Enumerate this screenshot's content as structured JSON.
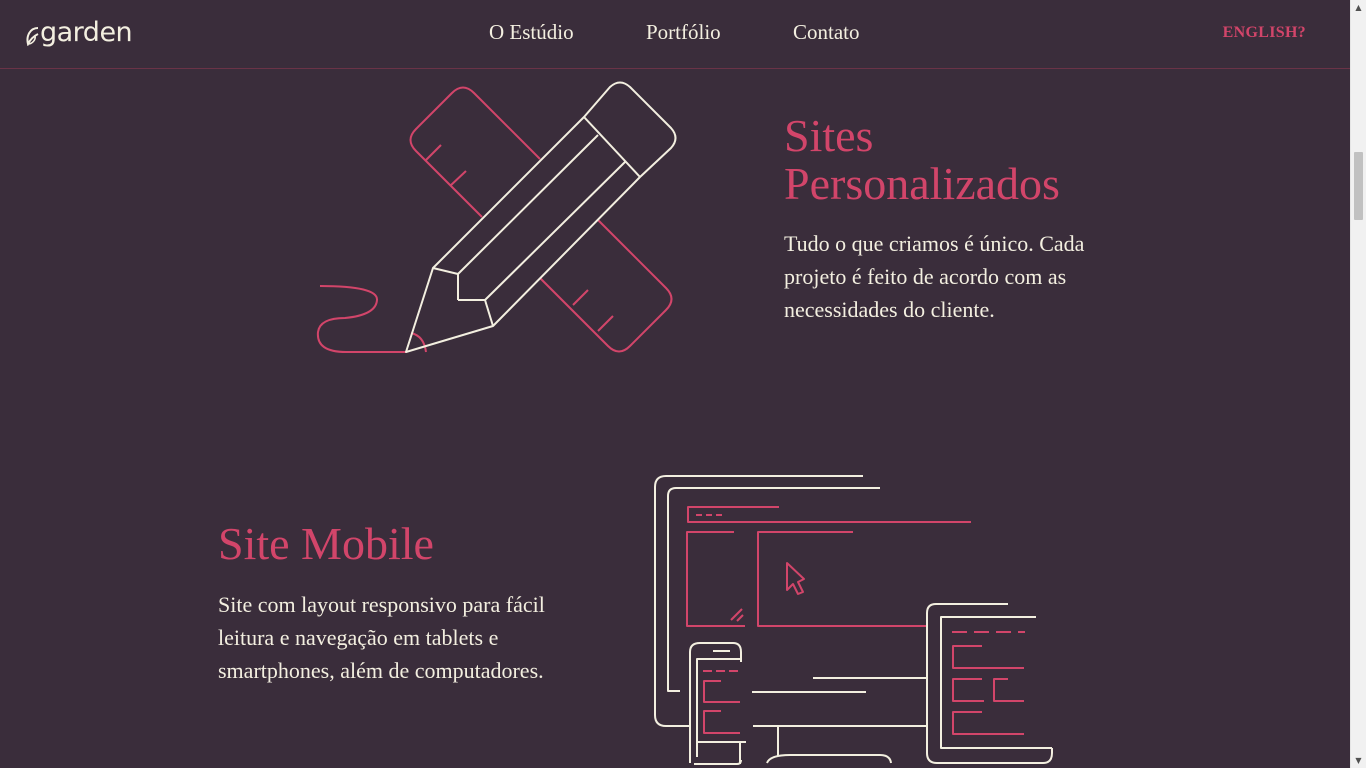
{
  "brand": {
    "name": "garden"
  },
  "nav": {
    "items": [
      "O Estúdio",
      "Portfólio",
      "Contato"
    ],
    "language_link": "ENGLISH?"
  },
  "sections": [
    {
      "title": "Sites Personalizados",
      "text": "Tudo o que criamos é único. Cada projeto é feito de acordo com as necessidades do cliente.",
      "illustration": "pencil-ruler-icon"
    },
    {
      "title": "Site Mobile",
      "text": "Site com layout responsivo para fácil leitura e navegação em tablets e smartphones, além de computadores.",
      "illustration": "responsive-devices-icon"
    }
  ],
  "colors": {
    "background": "#3a2d3b",
    "accent": "#d2456a",
    "text": "#f3efe0",
    "divider": "#6a3347"
  }
}
